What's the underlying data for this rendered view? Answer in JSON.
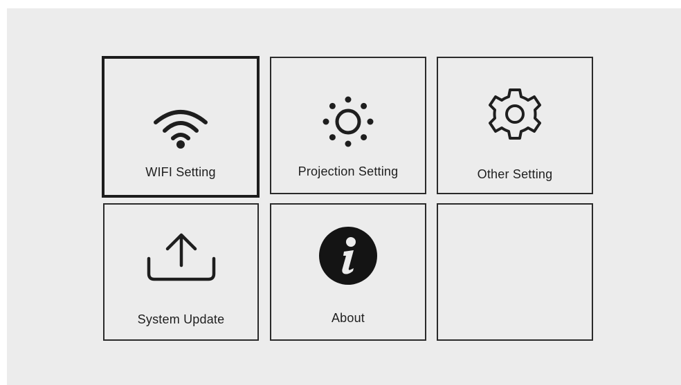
{
  "menu": {
    "tiles": [
      {
        "label": "WIFI Setting",
        "icon": "wifi-icon",
        "selected": true
      },
      {
        "label": "Projection Setting",
        "icon": "brightness-icon",
        "selected": false
      },
      {
        "label": "Other Setting",
        "icon": "gear-icon",
        "selected": false
      },
      {
        "label": "System Update",
        "icon": "upload-icon",
        "selected": false
      },
      {
        "label": "About",
        "icon": "info-icon",
        "selected": false
      },
      {
        "label": "",
        "icon": "",
        "selected": false
      }
    ]
  },
  "colors": {
    "background": "#ececec",
    "border": "#2a2a2a",
    "text": "#1e1e1e"
  }
}
